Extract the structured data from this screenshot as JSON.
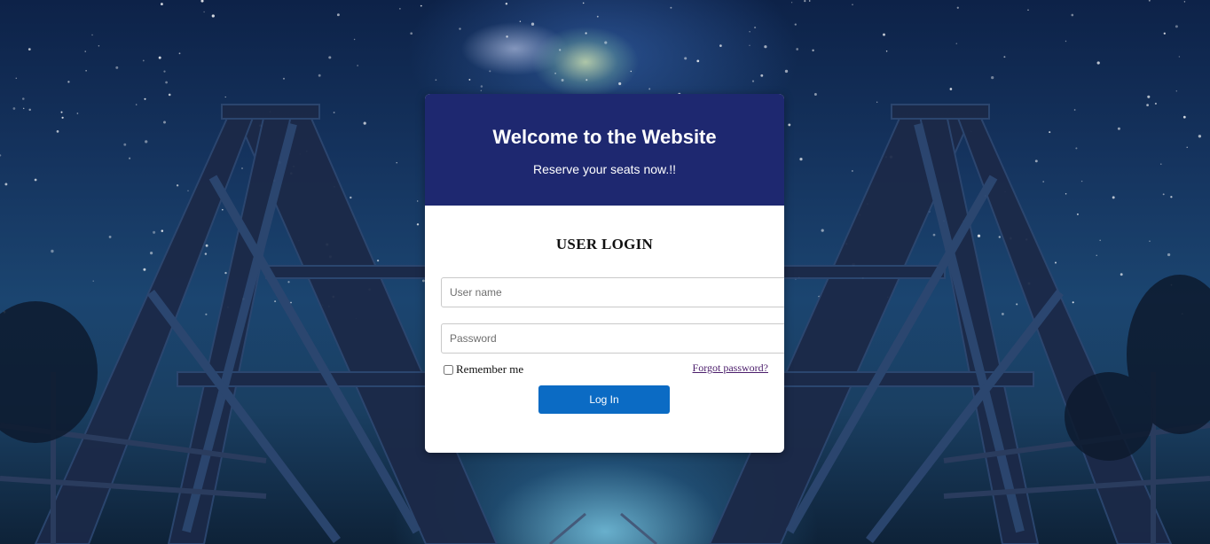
{
  "header": {
    "title": "Welcome to the Website",
    "subtitle": "Reserve your seats now.!!"
  },
  "login": {
    "heading": "USER LOGIN",
    "username_placeholder": "User name",
    "username_value": "",
    "password_placeholder": "Password",
    "password_value": "",
    "remember_label": "Remember me",
    "remember_checked": false,
    "forgot_label": "Forgot password?",
    "submit_label": "Log In"
  },
  "colors": {
    "header_bg": "#1e2870",
    "button_bg": "#0b6bc4",
    "link": "#4b1d6b"
  }
}
